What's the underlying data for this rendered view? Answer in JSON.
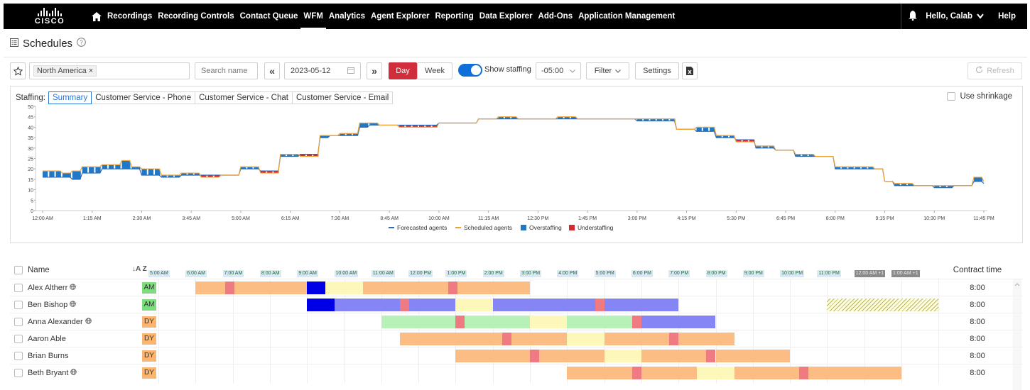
{
  "nav": {
    "logo_text": "CISCO",
    "items": [
      "Recordings",
      "Recording Controls",
      "Contact Queue",
      "WFM",
      "Analytics",
      "Agent Explorer",
      "Reporting",
      "Data Explorer",
      "Add-Ons",
      "Application Management"
    ],
    "active_item": "WFM",
    "greeting": "Hello, Calab",
    "help": "Help"
  },
  "page": {
    "title": "Schedules"
  },
  "toolbar": {
    "region_chip": "North America ×",
    "search_placeholder": "Search name",
    "prev_label": "«",
    "date": "2023-05-12",
    "next_label": "»",
    "day_label": "Day",
    "week_label": "Week",
    "show_staffing_label": "Show staffing",
    "timezone": "-05:00",
    "filter_label": "Filter",
    "settings_label": "Settings",
    "refresh_label": "Refresh"
  },
  "staffing": {
    "label": "Staffing:",
    "tabs": [
      "Summary",
      "Customer Service - Phone",
      "Customer Service - Chat",
      "Customer Service - Email"
    ],
    "active_tab": "Summary",
    "use_shrinkage_label": "Use shrinkage"
  },
  "chart_data": {
    "type": "line",
    "y_ticks": [
      "50",
      "45",
      "40",
      "35",
      "30",
      "25",
      "20",
      "15",
      "10",
      "5",
      "0"
    ],
    "ylim": [
      0,
      50
    ],
    "x_ticks": [
      "12:00 AM",
      "1:15 AM",
      "2:30 AM",
      "3:45 AM",
      "5:00 AM",
      "6:15 AM",
      "7:30 AM",
      "8:45 AM",
      "10:00 AM",
      "11:15 AM",
      "12:30 PM",
      "1:45 PM",
      "3:00 PM",
      "4:15 PM",
      "5:30 PM",
      "6:45 PM",
      "8:00 PM",
      "9:15 PM",
      "10:30 PM",
      "11:45 PM"
    ],
    "x_hours": [
      0,
      1.25,
      2.5,
      3.75,
      5,
      6.25,
      7.5,
      8.75,
      10,
      11.25,
      12.5,
      13.75,
      15,
      16.25,
      17.5,
      18.75,
      20,
      21.25,
      22.5,
      23.75
    ],
    "legend": [
      "Forecasted agents",
      "Scheduled agents",
      "Overstaffing",
      "Understaffing"
    ],
    "colors": {
      "forecast": "#2e6ab3",
      "scheduled": "#f0a030",
      "over": "#1f78c8",
      "under": "#d6282f"
    },
    "series": [
      {
        "name": "Forecasted agents",
        "x": [
          0,
          0.5,
          0.75,
          1,
          1.5,
          2,
          2.25,
          2.5,
          3,
          3.5,
          4,
          4.5,
          5,
          5.5,
          6,
          6.5,
          7,
          7.25,
          7.5,
          8,
          8.25,
          8.5,
          9,
          9.5,
          10,
          10.5,
          11,
          11.5,
          12,
          12.5,
          13,
          13.5,
          14,
          14.5,
          15,
          15.5,
          16,
          16.5,
          17,
          17.5,
          18,
          18.5,
          19,
          19.5,
          20,
          20.5,
          21,
          21.25,
          21.5,
          22,
          22.5,
          23,
          23.5,
          23.75
        ],
        "y": [
          16,
          16,
          15,
          18,
          20,
          20,
          20,
          17,
          16,
          17,
          17,
          17,
          20,
          19,
          26,
          27,
          35,
          36,
          36,
          40,
          41,
          41,
          41,
          41,
          42,
          42,
          44,
          44,
          44,
          44,
          44,
          44,
          44,
          44,
          43,
          43,
          39,
          38,
          35,
          34,
          30,
          29,
          26,
          26,
          20,
          20,
          20,
          14,
          12,
          12,
          11,
          12,
          14,
          13
        ]
      },
      {
        "name": "Scheduled agents",
        "x": [
          0,
          0.5,
          0.75,
          1,
          1.5,
          2,
          2.25,
          2.5,
          3,
          3.5,
          4,
          4.5,
          5,
          5.5,
          6,
          6.5,
          7,
          7.25,
          7.5,
          8,
          8.25,
          8.5,
          9,
          9.5,
          10,
          10.5,
          11,
          11.5,
          12,
          12.5,
          13,
          13.5,
          14,
          14.5,
          15,
          15.5,
          16,
          16.5,
          17,
          17.5,
          18,
          18.5,
          19,
          19.5,
          20,
          20.5,
          21,
          21.25,
          21.5,
          22,
          22.5,
          23,
          23.5,
          23.75
        ],
        "y": [
          19,
          18,
          19,
          21,
          22,
          24,
          21,
          20,
          17,
          18,
          16,
          17,
          21,
          18,
          27,
          26,
          36,
          36,
          37,
          42,
          42,
          41,
          40,
          40,
          42,
          42,
          44,
          45,
          44,
          44,
          45,
          44,
          44,
          44,
          44,
          44,
          39,
          40,
          36,
          33,
          31,
          29,
          27,
          26,
          21,
          21,
          20,
          14,
          13,
          12,
          12,
          12,
          16,
          14
        ]
      }
    ]
  },
  "schedule": {
    "columns": {
      "name": "Name",
      "contract": "Contract time"
    },
    "sort_icon": "↓A Z",
    "hours": [
      "5:00 AM",
      "6:00 AM",
      "7:00 AM",
      "8:00 AM",
      "9:00 AM",
      "10:00 AM",
      "11:00 AM",
      "12:00 PM",
      "1:00 PM",
      "2:00 PM",
      "3:00 PM",
      "4:00 PM",
      "5:00 PM",
      "6:00 PM",
      "7:00 PM",
      "8:00 PM",
      "9:00 PM",
      "10:00 PM",
      "11:00 PM",
      "12:00 AM +1",
      "1:00 AM +1"
    ],
    "rows": [
      {
        "name": "Alex Altherr",
        "globe": true,
        "badge": "AM",
        "contract": "8:00"
      },
      {
        "name": "Ben Bishop",
        "globe": true,
        "badge": "AM",
        "contract": "8:00"
      },
      {
        "name": "Anna Alexander",
        "globe": true,
        "badge": "DY",
        "contract": "8:00"
      },
      {
        "name": "Aaron Able",
        "globe": false,
        "badge": "DY",
        "contract": "8:00"
      },
      {
        "name": "Brian Burns",
        "globe": false,
        "badge": "DY",
        "contract": "8:00"
      },
      {
        "name": "Beth Bryant",
        "globe": true,
        "badge": "DY",
        "contract": "8:00"
      }
    ],
    "colors": {
      "work": "#fbbd84",
      "break": "#f07a82",
      "lunch": "#fdf7b9",
      "meeting": "#0000e6",
      "project": "#8585f5",
      "training": "#b8f1b8",
      "unavail": "#b8b85a"
    }
  }
}
